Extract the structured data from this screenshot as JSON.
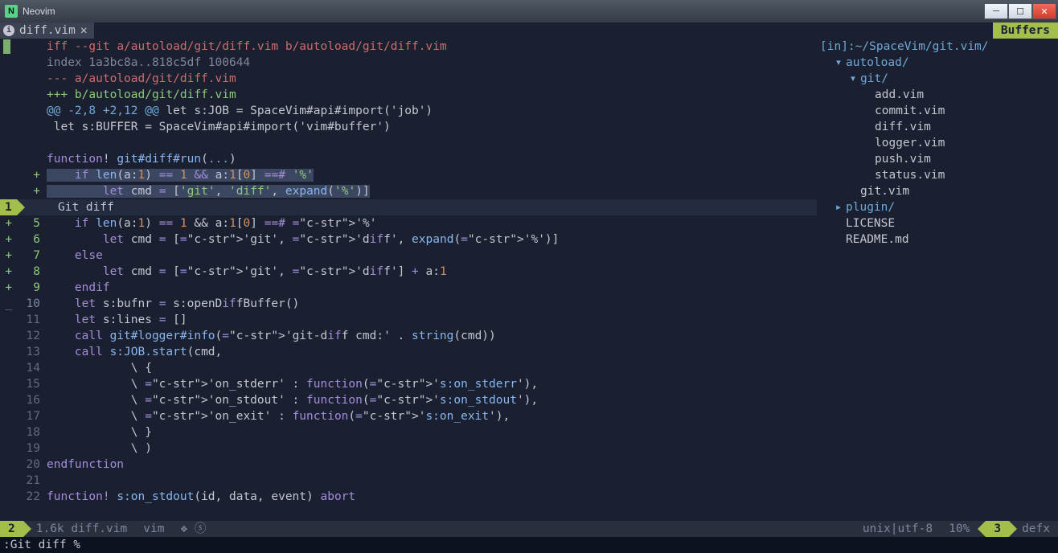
{
  "window": {
    "title": "Neovim"
  },
  "tabline": {
    "filename": "diff.vim",
    "close_glyph": "✕",
    "buffers_label": "Buffers"
  },
  "pathline": {
    "label": "[in]: ",
    "path": "~/SpaceVim/git.vim/"
  },
  "diff_header": {
    "line1_pre": "iff --git ",
    "line1_a": "a/autoload/git/diff.vim",
    "line1_b": " b/autoload/git/diff.vim",
    "line2": "index 1a3bc8a..818c5df 100644",
    "line3": "--- a/autoload/git/diff.vim",
    "line4": "+++ b/autoload/git/diff.vim",
    "hunk_pre": "@@ -2,8 +2,12 @@",
    "hunk_ctx": " let s:JOB = SpaceVim#api#import('job')"
  },
  "context_line": " let s:BUFFER = SpaceVim#api#import('vim#buffer')",
  "func_line": "function! git#diff#run(...)",
  "sel1": "    if len(a:1) == 1 && a:1[0] ==# '%'",
  "sel2": "        let cmd = ['git', 'diff', expand('%')]",
  "cursor_badge": "1",
  "cursor_text": "Git diff",
  "lines": [
    {
      "g": "+",
      "n": "5",
      "t": "    if len(a:1) == 1 && a:1[0] ==# '%'",
      "hl": "if"
    },
    {
      "g": "+",
      "n": "6",
      "t": "        let cmd = ['git', 'diff', expand('%')]",
      "hl": "let"
    },
    {
      "g": "+",
      "n": "7",
      "t": "    else",
      "hl": "else"
    },
    {
      "g": "+",
      "n": "8",
      "t": "        let cmd = ['git', 'diff'] + a:1",
      "hl": "let"
    },
    {
      "g": "+",
      "n": "9",
      "t": "    endif",
      "hl": "endif"
    },
    {
      "g": "_",
      "n": "10",
      "t": "    let s:bufnr = s:openDiffBuffer()",
      "hl": "let"
    },
    {
      "g": "",
      "n": "11",
      "t": "    let s:lines = []",
      "hl": "let"
    },
    {
      "g": "",
      "n": "12",
      "t": "    call git#logger#info('git-diff cmd:' . string(cmd))",
      "hl": "call"
    },
    {
      "g": "",
      "n": "13",
      "t": "    call s:JOB.start(cmd,",
      "hl": "call"
    },
    {
      "g": "",
      "n": "14",
      "t": "            \\ {",
      "hl": ""
    },
    {
      "g": "",
      "n": "15",
      "t": "            \\ 'on_stderr' : function('s:on_stderr'),",
      "hl": "str"
    },
    {
      "g": "",
      "n": "16",
      "t": "            \\ 'on_stdout' : function('s:on_stdout'),",
      "hl": "str"
    },
    {
      "g": "",
      "n": "17",
      "t": "            \\ 'on_exit' : function('s:on_exit'),",
      "hl": "str"
    },
    {
      "g": "",
      "n": "18",
      "t": "            \\ }",
      "hl": ""
    },
    {
      "g": "",
      "n": "19",
      "t": "            \\ )",
      "hl": ""
    },
    {
      "g": "",
      "n": "20",
      "t": "endfunction",
      "hl": "endfunction"
    },
    {
      "g": "",
      "n": "21",
      "t": "",
      "hl": ""
    },
    {
      "g": "",
      "n": "22",
      "t": "function! s:on_stdout(id, data, event) abort",
      "hl": "function"
    }
  ],
  "tree": {
    "items": [
      {
        "ind": 1,
        "arrow": "▾",
        "name": "autoload/",
        "type": "dir"
      },
      {
        "ind": 2,
        "arrow": "▾",
        "name": "git/",
        "type": "dir"
      },
      {
        "ind": 3,
        "arrow": "",
        "name": "add.vim",
        "type": "file"
      },
      {
        "ind": 3,
        "arrow": "",
        "name": "commit.vim",
        "type": "file"
      },
      {
        "ind": 3,
        "arrow": "",
        "name": "diff.vim",
        "type": "file"
      },
      {
        "ind": 3,
        "arrow": "",
        "name": "logger.vim",
        "type": "file"
      },
      {
        "ind": 3,
        "arrow": "",
        "name": "push.vim",
        "type": "file"
      },
      {
        "ind": 3,
        "arrow": "",
        "name": "status.vim",
        "type": "file"
      },
      {
        "ind": 2,
        "arrow": "",
        "name": "git.vim",
        "type": "file"
      },
      {
        "ind": 1,
        "arrow": "▸",
        "name": "plugin/",
        "type": "dir"
      },
      {
        "ind": 1,
        "arrow": "",
        "name": "LICENSE",
        "type": "file"
      },
      {
        "ind": 1,
        "arrow": "",
        "name": "README.md",
        "type": "file"
      }
    ]
  },
  "status": {
    "left_num": "2",
    "size": "1.6k",
    "fname": "diff.vim",
    "ft": "vim",
    "glyphs": "❖ ⓢ",
    "enc": "unix|utf-8",
    "pct": "10%",
    "right_num": "3",
    "right_name": "defx"
  },
  "cmdline": ":Git diff %"
}
